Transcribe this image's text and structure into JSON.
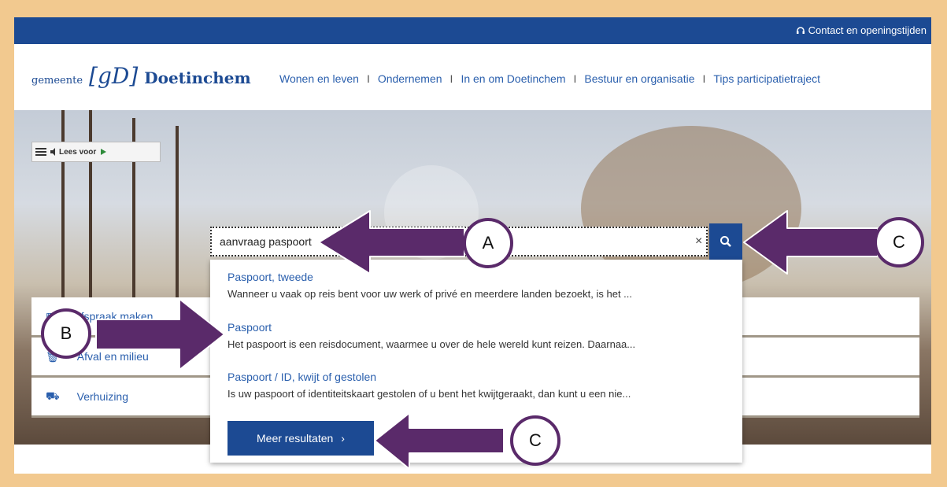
{
  "topbar": {
    "contact_label": "Contact en openingstijden"
  },
  "logo": {
    "prefix": "gemeente",
    "mark": "[gD]",
    "name": "Doetinchem"
  },
  "nav": {
    "items": [
      "Wonen en leven",
      "Ondernemen",
      "In en om Doetinchem",
      "Bestuur en organisatie",
      "Tips participatietraject"
    ]
  },
  "reader": {
    "label": "Lees voor"
  },
  "tiles": [
    "Afspraak maken",
    "Afval en milieu",
    "Verhuizing"
  ],
  "search": {
    "value": "aanvraag paspoort",
    "clear": "×"
  },
  "results": [
    {
      "title": "Paspoort, tweede",
      "desc": "Wanneer u vaak op reis bent voor uw werk of privé en meerdere landen bezoekt, is het ..."
    },
    {
      "title": "Paspoort",
      "desc": "Het paspoort is een reisdocument, waarmee u over de hele wereld kunt reizen. Daarnaa..."
    },
    {
      "title": "Paspoort / ID, kwijt of gestolen",
      "desc": "Is uw paspoort of identiteitskaart gestolen of u bent het kwijtgeraakt, dan kunt u een nie..."
    }
  ],
  "more_button": {
    "label": "Meer resultaten",
    "chevron": "›"
  },
  "annotations": {
    "a": "A",
    "b": "B",
    "c1": "C",
    "c2": "C"
  },
  "colors": {
    "brand_blue": "#1c4a93",
    "link_blue": "#2a5fad",
    "arrow_purple": "#5a2a6a",
    "border_orange": "#f2c98f"
  }
}
